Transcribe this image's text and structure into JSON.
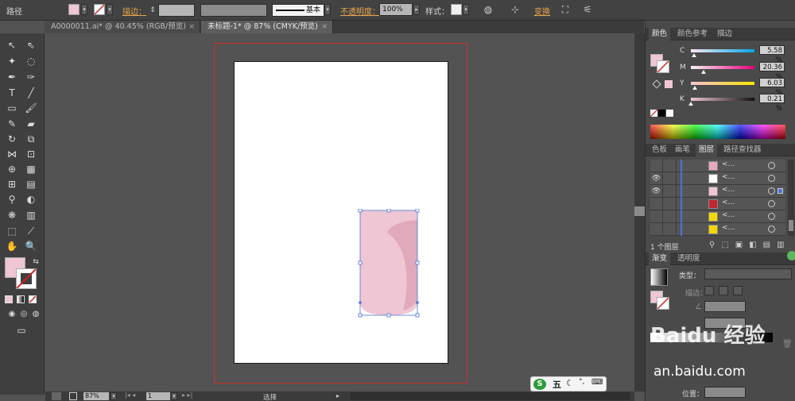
{
  "control_bar": {
    "object_type": "路径",
    "stroke_label": "描边：",
    "stroke_style": "基本",
    "opacity_label": "不透明度：",
    "opacity_value": "100%",
    "style_label": "样式：",
    "transform_label": "变换"
  },
  "tabs": [
    {
      "label": "A0000011.ai* @ 40.45% (RGB/预览)",
      "close": "×"
    },
    {
      "label": "未标题-1* @ 87% (CMYK/预览)",
      "close": "×"
    }
  ],
  "status_bar": {
    "zoom": "87%",
    "artboard_num": "1",
    "tool_name": "选择"
  },
  "color_panel": {
    "tabs": [
      "颜色",
      "颜色参考",
      "描边"
    ],
    "channels": [
      {
        "label": "C",
        "value": "5.58 %",
        "level": 0.0558
      },
      {
        "label": "M",
        "value": "20.36 %",
        "level": 0.2036
      },
      {
        "label": "Y",
        "value": "6.03 %",
        "level": 0.0603
      },
      {
        "label": "K",
        "value": "0.21 %",
        "level": 0.0021
      }
    ],
    "fill_color": "#efc6d4"
  },
  "layers_panel": {
    "tabs": [
      "色板",
      "画笔",
      "图层",
      "路径查找器"
    ],
    "rows": [
      {
        "name": "<...",
        "eye": false,
        "thumb": "#e8a8c0"
      },
      {
        "name": "<...",
        "eye": true,
        "thumb": "#ffffff"
      },
      {
        "name": "<...",
        "eye": true,
        "thumb": "#efc6d4"
      },
      {
        "name": "<...",
        "eye": false,
        "thumb": "#c0262c"
      },
      {
        "name": "<...",
        "eye": false,
        "thumb": "#f2d800"
      },
      {
        "name": "<...",
        "eye": false,
        "thumb": "#f2d800"
      }
    ],
    "footer": "1 个图层"
  },
  "gradient_panel": {
    "tabs": [
      "渐变",
      "透明度"
    ],
    "type_label": "类型：",
    "stroke_label": "描边：",
    "position_label": "位置："
  },
  "ime": {
    "label": "五"
  },
  "watermark": {
    "line1": "Baidu 经验",
    "line2": "an.baidu.com"
  }
}
